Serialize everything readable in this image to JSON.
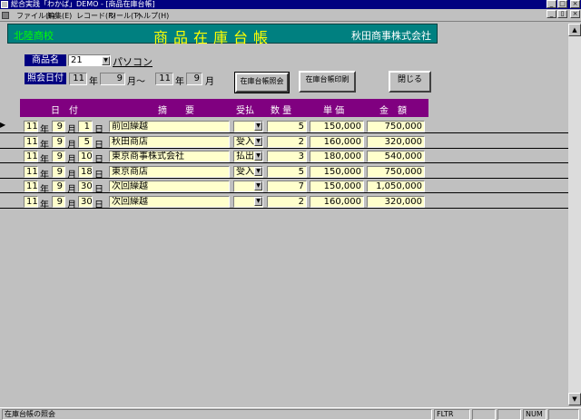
{
  "window": {
    "title": "総合実践「わかば」DEMO - [商品在庫台帳]",
    "controls": [
      "_",
      "□",
      "×"
    ],
    "inner_controls": [
      "_",
      "▯",
      "×"
    ]
  },
  "menu": [
    "ファイル(F)",
    "編集(E)",
    "レコード(R)",
    "ツール(T)",
    "ヘルプ(H)"
  ],
  "header": {
    "school": "北陸商校",
    "title": "商品在庫台帳",
    "company": "秋田商事株式会社"
  },
  "product": {
    "label": "商品名",
    "code": "21",
    "name": "パソコン"
  },
  "period": {
    "label": "照会日付",
    "from_year": "11",
    "from_month": "9",
    "to_year": "11",
    "to_month": "9",
    "year_unit": "年",
    "month_unit": "月",
    "tilde": "～"
  },
  "buttons": {
    "query": "在庫台帳照会",
    "print": "在庫台帳印刷",
    "close": "閉じる"
  },
  "columns": {
    "date": "日　付",
    "summary": "摘　　要",
    "type": "受払",
    "qty": "数 量",
    "price": "単 価",
    "amount": "金　額"
  },
  "units": {
    "year": "年",
    "month": "月",
    "day": "日"
  },
  "rows": [
    {
      "year": "11",
      "month": "9",
      "day": "1",
      "summary": "前回繰越",
      "type": "",
      "qty": "5",
      "price": "150,000",
      "amount": "750,000"
    },
    {
      "year": "11",
      "month": "9",
      "day": "5",
      "summary": "秋田商店",
      "type": "受入",
      "qty": "2",
      "price": "160,000",
      "amount": "320,000"
    },
    {
      "year": "11",
      "month": "9",
      "day": "10",
      "summary": "東京商事株式会社",
      "type": "払出",
      "qty": "3",
      "price": "180,000",
      "amount": "540,000"
    },
    {
      "year": "11",
      "month": "9",
      "day": "18",
      "summary": "東京商店",
      "type": "受入",
      "qty": "5",
      "price": "150,000",
      "amount": "750,000"
    },
    {
      "year": "11",
      "month": "9",
      "day": "30",
      "summary": "次回繰越",
      "type": "",
      "qty": "7",
      "price": "150,000",
      "amount": "1,050,000"
    },
    {
      "year": "11",
      "month": "9",
      "day": "30",
      "summary": "次回繰越",
      "type": "",
      "qty": "2",
      "price": "160,000",
      "amount": "320,000"
    }
  ],
  "record_indicator": "▶",
  "status": {
    "message": "在庫台帳の照会",
    "filter": "FLTR",
    "num": "NUM"
  },
  "colors": {
    "titlebar": "#000080",
    "header_band": "#008080",
    "school_text": "#00ff00",
    "title_text": "#ffff00",
    "column_header": "#800080",
    "cell_bg": "#ffffcc",
    "form_bg": "#c0c0c0"
  }
}
